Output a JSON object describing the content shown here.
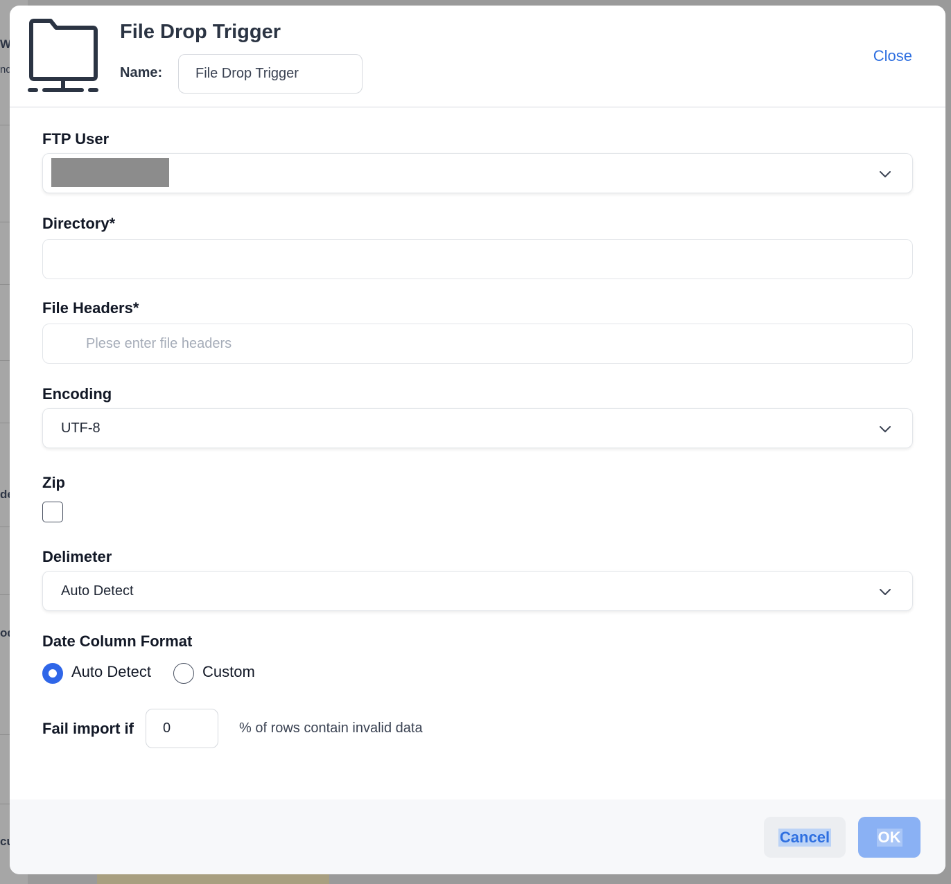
{
  "background": {
    "fragments": [
      "W",
      "nd",
      "de",
      "od",
      "cu"
    ]
  },
  "dialog": {
    "title": "File Drop Trigger",
    "name_label": "Name:",
    "name_value": "File Drop Trigger",
    "close_label": "Close",
    "icon": "folder-network-icon"
  },
  "form": {
    "ftp_user": {
      "label": "FTP User",
      "value": ""
    },
    "directory": {
      "label": "Directory*",
      "value": ""
    },
    "file_headers": {
      "label": "File Headers*",
      "placeholder": "Plese enter file headers",
      "value": ""
    },
    "encoding": {
      "label": "Encoding",
      "value": "UTF-8"
    },
    "zip": {
      "label": "Zip",
      "checked": false
    },
    "delimeter": {
      "label": "Delimeter",
      "value": "Auto Detect"
    },
    "date_column_format": {
      "label": "Date Column Format",
      "options": [
        {
          "label": "Auto Detect",
          "selected": true
        },
        {
          "label": "Custom",
          "selected": false
        }
      ]
    },
    "fail_import": {
      "prefix": "Fail import if",
      "value": "0",
      "suffix": "% of rows contain invalid data"
    }
  },
  "footer": {
    "cancel_label": "Cancel",
    "ok_label": "OK"
  },
  "colors": {
    "accent": "#2e6fe0",
    "radio_selected": "#2f66e8",
    "ok_button": "#8ab1f4",
    "title_text": "#2b3443"
  }
}
